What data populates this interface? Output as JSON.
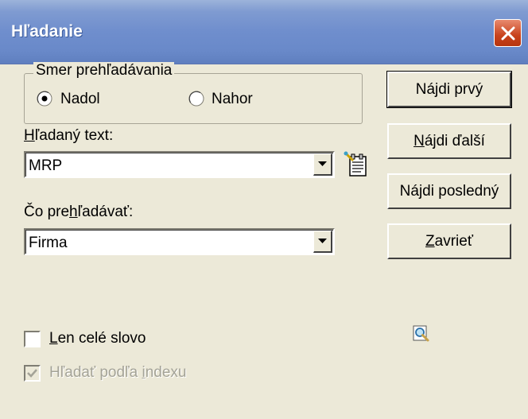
{
  "window": {
    "title": "Hľadanie"
  },
  "direction": {
    "legend": "Smer prehľadávania",
    "options": [
      {
        "label": "Nadol",
        "selected": true
      },
      {
        "label": "Nahor",
        "selected": false
      }
    ]
  },
  "search_text": {
    "label_accel": "H",
    "label_rest": "ľadaný text:",
    "value": "MRP"
  },
  "search_in": {
    "label_pre": "Čo pre",
    "label_accel": "h",
    "label_rest": "ľadávať:",
    "value": "Firma"
  },
  "buttons": {
    "find_first": {
      "pre": "Ná",
      "accel": "j",
      "post": "di prvý"
    },
    "find_next": {
      "pre": "",
      "accel": "N",
      "post": "ájdi ďalší"
    },
    "find_last": {
      "pre": "Nájdi posledný",
      "accel": "",
      "post": ""
    },
    "close": {
      "pre": "",
      "accel": "Z",
      "post": "avrieť"
    }
  },
  "options": {
    "whole_word": {
      "accel": "L",
      "rest": "en celé slovo",
      "checked": false
    },
    "by_index": {
      "pre": "Hľadať podľa ",
      "accel": "i",
      "rest": "ndexu",
      "checked": true,
      "enabled": false
    }
  },
  "icons": {
    "text_picker": "notepad-wand-icon",
    "preview": "magnifier-icon"
  },
  "colors": {
    "titlebar": "#7f9bd1",
    "dialog_bg": "#ece9d8",
    "close_button": "#c8421c"
  }
}
